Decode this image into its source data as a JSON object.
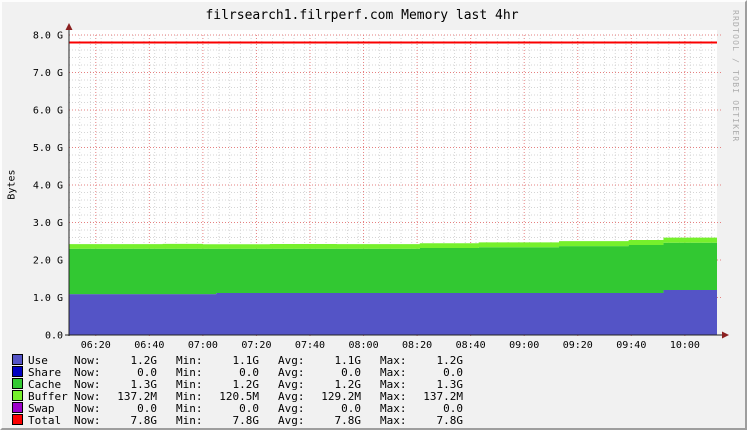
{
  "window": {
    "title": "filrsearch1.filrperf.com Memory last 4hr"
  },
  "watermark": "RRDTOOL / TOBI OETIKER",
  "colors": {
    "background": "#f1f1f1",
    "canvas": "#ffffff",
    "grid_minor": "#d5d5d5",
    "grid_major": "#e58080",
    "axis": "#222222",
    "arrow": "#8b2020",
    "use": "#5454c6",
    "share": "#0000c0",
    "cache": "#32c832",
    "buffer": "#76f02c",
    "swap": "#9c00c8",
    "total": "#fa0000"
  },
  "chart_data": {
    "type": "area",
    "stacked": true,
    "title": "filrsearch1.filrperf.com Memory last 4hr",
    "xlabel": "",
    "ylabel": "Bytes",
    "ylim": [
      0,
      8.0
    ],
    "grid": "on",
    "legend_position": "bottom",
    "x_range_minutes": [
      0,
      242
    ],
    "y_ticks": [
      {
        "v": 0,
        "label": "0.0"
      },
      {
        "v": 1,
        "label": "1.0 G"
      },
      {
        "v": 2,
        "label": "2.0 G"
      },
      {
        "v": 3,
        "label": "3.0 G"
      },
      {
        "v": 4,
        "label": "4.0 G"
      },
      {
        "v": 5,
        "label": "5.0 G"
      },
      {
        "v": 6,
        "label": "6.0 G"
      },
      {
        "v": 7,
        "label": "7.0 G"
      },
      {
        "v": 8,
        "label": "8.0 G"
      }
    ],
    "x_ticks": [
      {
        "t": 10,
        "label": "06:20"
      },
      {
        "t": 30,
        "label": "06:40"
      },
      {
        "t": 50,
        "label": "07:00"
      },
      {
        "t": 70,
        "label": "07:20"
      },
      {
        "t": 90,
        "label": "07:40"
      },
      {
        "t": 110,
        "label": "08:00"
      },
      {
        "t": 130,
        "label": "08:20"
      },
      {
        "t": 150,
        "label": "08:40"
      },
      {
        "t": 170,
        "label": "09:00"
      },
      {
        "t": 190,
        "label": "09:20"
      },
      {
        "t": 210,
        "label": "09:40"
      },
      {
        "t": 230,
        "label": "10:00"
      }
    ],
    "minor_x_step_minutes": 4,
    "minor_y_step": 0.2,
    "series": [
      {
        "name": "Use",
        "color": "#5454c6",
        "unit": "G",
        "points": [
          [
            0,
            1.09
          ],
          [
            55,
            1.12
          ],
          [
            222,
            1.2
          ],
          [
            242,
            1.21
          ]
        ]
      },
      {
        "name": "Share",
        "color": "#0000c0",
        "unit": "G",
        "points": [
          [
            0,
            0
          ],
          [
            242,
            0
          ]
        ]
      },
      {
        "name": "Cache",
        "color": "#32c832",
        "unit": "G",
        "points": [
          [
            0,
            1.21
          ],
          [
            55,
            1.18
          ],
          [
            131,
            1.2
          ],
          [
            153,
            1.22
          ],
          [
            183,
            1.25
          ],
          [
            209,
            1.28
          ],
          [
            222,
            1.26
          ],
          [
            242,
            1.27
          ]
        ]
      },
      {
        "name": "Buffer",
        "color": "#76f02c",
        "unit": "G",
        "points": [
          [
            0,
            0.125
          ],
          [
            35,
            0.131
          ],
          [
            50,
            0.121
          ],
          [
            75,
            0.128
          ],
          [
            100,
            0.124
          ],
          [
            131,
            0.127
          ],
          [
            153,
            0.131
          ],
          [
            183,
            0.132
          ],
          [
            209,
            0.134
          ],
          [
            222,
            0.136
          ],
          [
            242,
            0.137
          ]
        ]
      },
      {
        "name": "Swap",
        "color": "#9c00c8",
        "unit": "G",
        "points": [
          [
            0,
            0
          ],
          [
            242,
            0
          ]
        ]
      }
    ],
    "total_line": {
      "name": "Total",
      "color": "#fa0000",
      "value": 7.8
    }
  },
  "legend": {
    "keys": {
      "now": "Now:",
      "min": "Min:",
      "avg": "Avg:",
      "max": "Max:"
    },
    "rows": [
      {
        "label": "Use",
        "color": "#5454c6",
        "now": "1.2G",
        "min": "1.1G",
        "avg": "1.1G",
        "max": "1.2G"
      },
      {
        "label": "Share",
        "color": "#0000c0",
        "now": "0.0",
        "min": "0.0",
        "avg": "0.0",
        "max": "0.0"
      },
      {
        "label": "Cache",
        "color": "#32c832",
        "now": "1.3G",
        "min": "1.2G",
        "avg": "1.2G",
        "max": "1.3G"
      },
      {
        "label": "Buffer",
        "color": "#76f02c",
        "now": "137.2M",
        "min": "120.5M",
        "avg": "129.2M",
        "max": "137.2M"
      },
      {
        "label": "Swap",
        "color": "#9c00c8",
        "now": "0.0",
        "min": "0.0",
        "avg": "0.0",
        "max": "0.0"
      },
      {
        "label": "Total",
        "color": "#fa0000",
        "now": "7.8G",
        "min": "7.8G",
        "avg": "7.8G",
        "max": "7.8G"
      }
    ]
  }
}
